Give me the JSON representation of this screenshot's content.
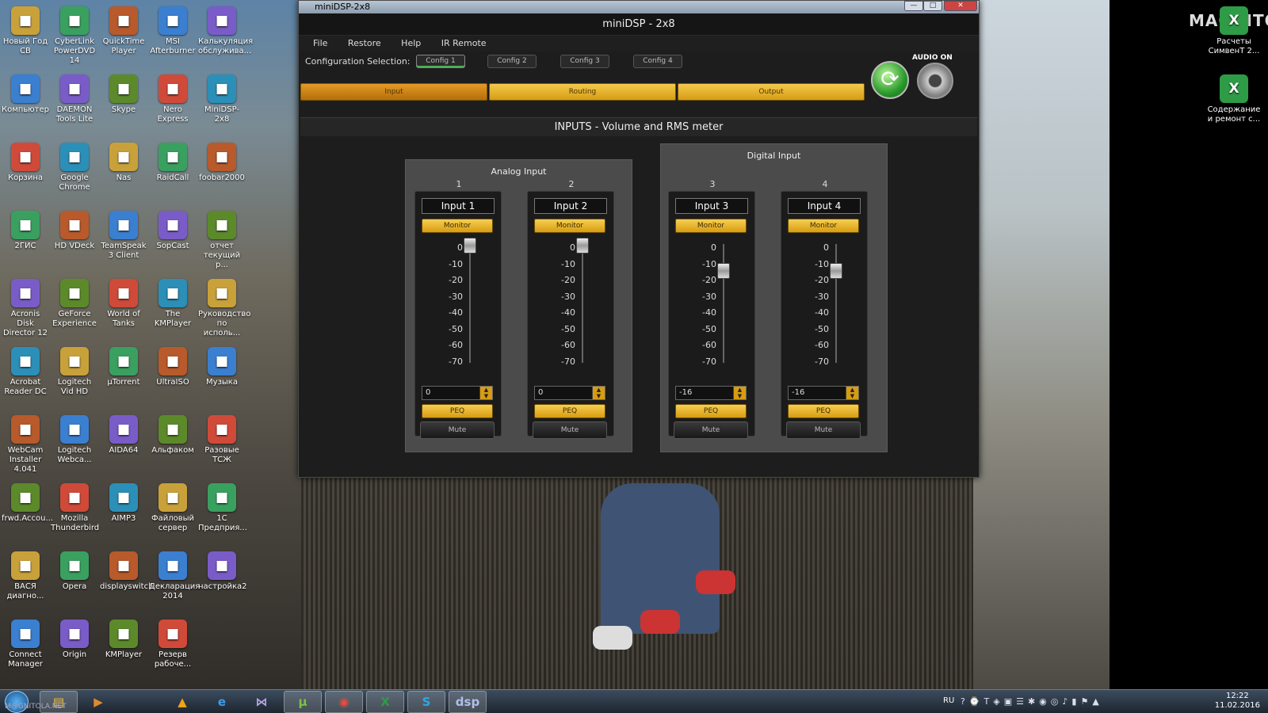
{
  "window": {
    "title": "miniDSP-2x8",
    "app_title": "miniDSP - 2x8",
    "controls": {
      "minimize": "—",
      "maximize": "□",
      "close": "✕"
    }
  },
  "menu": [
    "File",
    "Restore",
    "Help",
    "IR Remote"
  ],
  "config": {
    "label": "Configuration Selection:",
    "options": [
      "Config 1",
      "Config 2",
      "Config 3",
      "Config 4"
    ],
    "selected": "Config 1"
  },
  "tabs": [
    "Input",
    "Routing",
    "Output"
  ],
  "active_tab": "Input",
  "audio": {
    "label": "AUDIO ON"
  },
  "section_title": "INPUTS - Volume and RMS meter",
  "groups": {
    "analog": "Analog Input",
    "digital": "Digital Input"
  },
  "scale_labels": [
    "0",
    "-10",
    "-20",
    "-30",
    "-40",
    "-50",
    "-60",
    "-70"
  ],
  "channels": [
    {
      "num": "1",
      "name": "Input 1",
      "monitor": "Monitor",
      "gain": "0",
      "level_db": 0,
      "peq": "PEQ",
      "mute": "Mute"
    },
    {
      "num": "2",
      "name": "Input 2",
      "monitor": "Monitor",
      "gain": "0",
      "level_db": 0,
      "peq": "PEQ",
      "mute": "Mute"
    },
    {
      "num": "3",
      "name": "Input 3",
      "monitor": "Monitor",
      "gain": "-16",
      "level_db": -16,
      "peq": "PEQ",
      "mute": "Mute"
    },
    {
      "num": "4",
      "name": "Input 4",
      "monitor": "Monitor",
      "gain": "-16",
      "level_db": -16,
      "peq": "PEQ",
      "mute": "Mute"
    }
  ],
  "desktop": {
    "col1": [
      "Новый Год СВ",
      "Компьютер",
      "Корзина",
      "2ГИС",
      "Acronis Disk Director 12",
      "Acrobat Reader DC",
      "WebCam Installer 4.041",
      "frwd.Accou...",
      "ВАСЯ диагно...",
      "Connect Manager"
    ],
    "col2": [
      "CyberLink PowerDVD 14",
      "DAEMON Tools Lite",
      "Google Chrome",
      "HD VDeck",
      "GeForce Experience",
      "Logitech Vid HD",
      "Logitech Webca...",
      "Mozilla Thunderbird",
      "Opera",
      "Origin"
    ],
    "col3": [
      "QuickTime Player",
      "Skype",
      "Nas",
      "TeamSpeak 3 Client",
      "World of Tanks",
      "µTorrent",
      "AIDA64",
      "AIMP3",
      "displayswitch",
      "KMPlayer"
    ],
    "col4": [
      "MSI Afterburner",
      "Nero Express",
      "RaidCall",
      "SopCast",
      "The KMPlayer",
      "UltraISO",
      "Альфаком",
      "Файловый сервер",
      "Декларация 2014",
      "Резерв рабоче..."
    ],
    "col5": [
      "Калькуляция обслужива...",
      "MiniDSP-2x8",
      "foobar2000",
      "отчет текущий р...",
      "Руководство по исполь...",
      "Музыка",
      "Разовые ТСЖ",
      "1С Предприя...",
      "настройка2"
    ],
    "right": [
      "Расчеты СимвенТ 2...",
      "Содержание и ремонт с..."
    ]
  },
  "taskbar": {
    "watermark": "M@GNITOLA.NET",
    "language": "RU",
    "time": "12:22",
    "date": "11.02.2016",
    "icons": [
      "folder-icon",
      "media-player-icon",
      "aimp-icon",
      "ie-icon",
      "kmplayer-icon",
      "utorrent-icon",
      "chrome-icon",
      "excel-icon",
      "skype-icon",
      "minidsp-icon"
    ]
  },
  "corner_logo": "MAGNITOLA"
}
